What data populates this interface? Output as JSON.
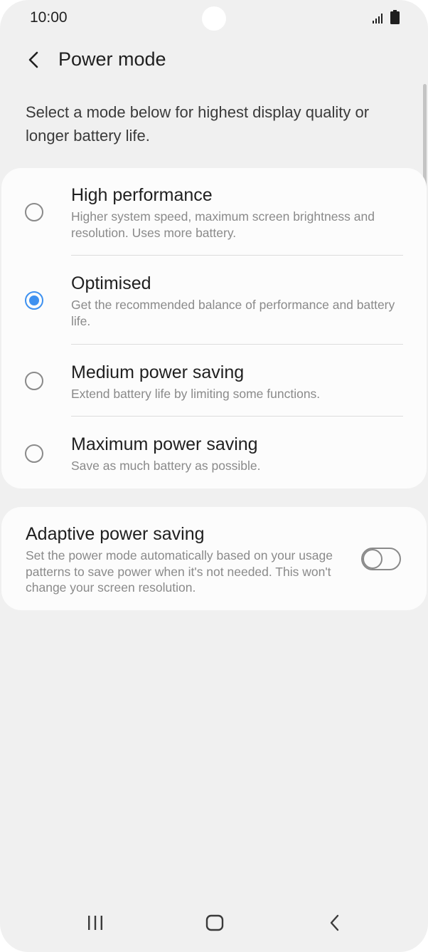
{
  "status_bar": {
    "time": "10:00",
    "icons": [
      "signal-icon",
      "battery-icon"
    ]
  },
  "header": {
    "title": "Power mode",
    "back_icon": "chevron-left-icon"
  },
  "description": "Select a mode below for highest display quality or longer battery life.",
  "modes": [
    {
      "title": "High performance",
      "description": "Higher system speed, maximum screen brightness and resolution. Uses more battery.",
      "selected": false
    },
    {
      "title": "Optimised",
      "description": "Get the recommended balance of performance and battery life.",
      "selected": true
    },
    {
      "title": "Medium power saving",
      "description": "Extend battery life by limiting some functions.",
      "selected": false
    },
    {
      "title": "Maximum power saving",
      "description": "Save as much battery as possible.",
      "selected": false
    }
  ],
  "adaptive": {
    "title": "Adaptive power saving",
    "description": "Set the power mode automatically based on your usage patterns to save power when it's not needed. This won't change your screen resolution.",
    "enabled": false
  },
  "navigation": {
    "icons": [
      "recent-apps-icon",
      "home-icon",
      "back-icon"
    ]
  },
  "colors": {
    "accent": "#3e91f0",
    "background": "#f0f0f0",
    "card": "#fcfcfc"
  }
}
